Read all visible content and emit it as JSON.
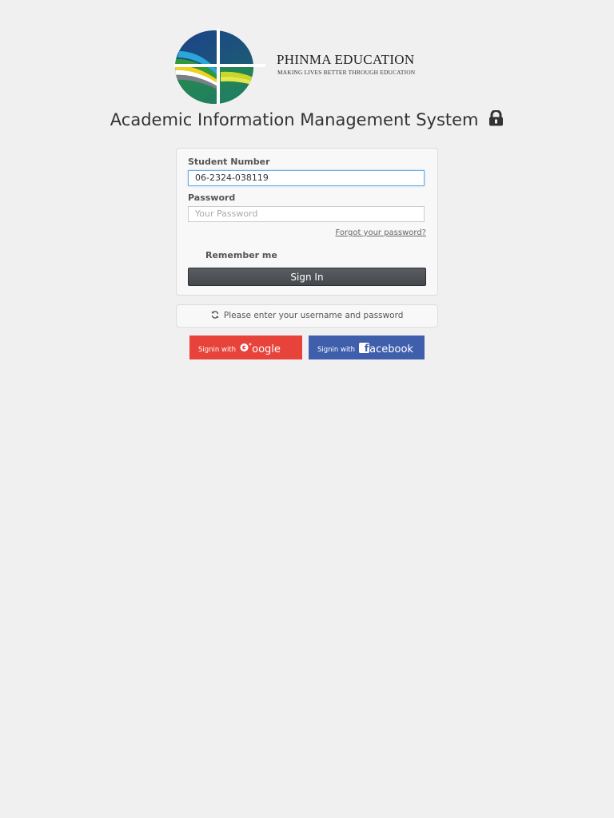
{
  "brand": {
    "name": "PHINMA EDUCATION",
    "tagline": "MAKING LIVES BETTER THROUGH EDUCATION"
  },
  "page": {
    "title": "Academic Information Management System",
    "title_icon": "lock-icon"
  },
  "login_form": {
    "student_number_label": "Student Number",
    "student_number_value": "06-2324-038119",
    "password_label": "Password",
    "password_placeholder": "Your Password",
    "forgot_password": "Forgot your password?",
    "remember_me": "Remember me",
    "sign_in": "Sign In"
  },
  "status": {
    "icon": "refresh-icon",
    "message": "Please enter your username and password"
  },
  "social": {
    "google": {
      "prefix": "Signin with",
      "brand": "oogle",
      "color": "#e8433a",
      "icon": "google-plus-icon"
    },
    "facebook": {
      "prefix": "Signin with",
      "brand": "acebook",
      "color": "#3f5fad",
      "icon": "facebook-icon"
    }
  },
  "colors": {
    "background": "#f0f0f0",
    "input_focus": "#66afe9",
    "sign_in_button": "#4e5155"
  }
}
